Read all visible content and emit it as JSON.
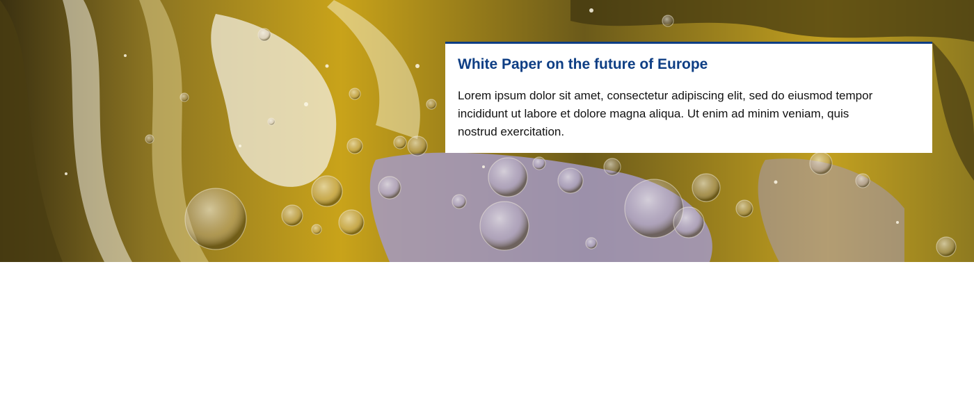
{
  "hero": {
    "image": "oil-and-water-bubbles-abstract",
    "colors": {
      "gold": "#c9a31a",
      "dark_olive": "#4a3d12",
      "lavender": "#a49ac4",
      "highlight": "#f2eee0"
    }
  },
  "card": {
    "title": "White Paper on the future of Europe",
    "body": "Lorem ipsum dolor sit amet, consectetur adipiscing elit, sed do eiusmod tempor incididunt ut labore et dolore magna aliqua. Ut enim ad minim veniam, quis nostrud exercitation.",
    "accent_color": "#0e3e84"
  }
}
